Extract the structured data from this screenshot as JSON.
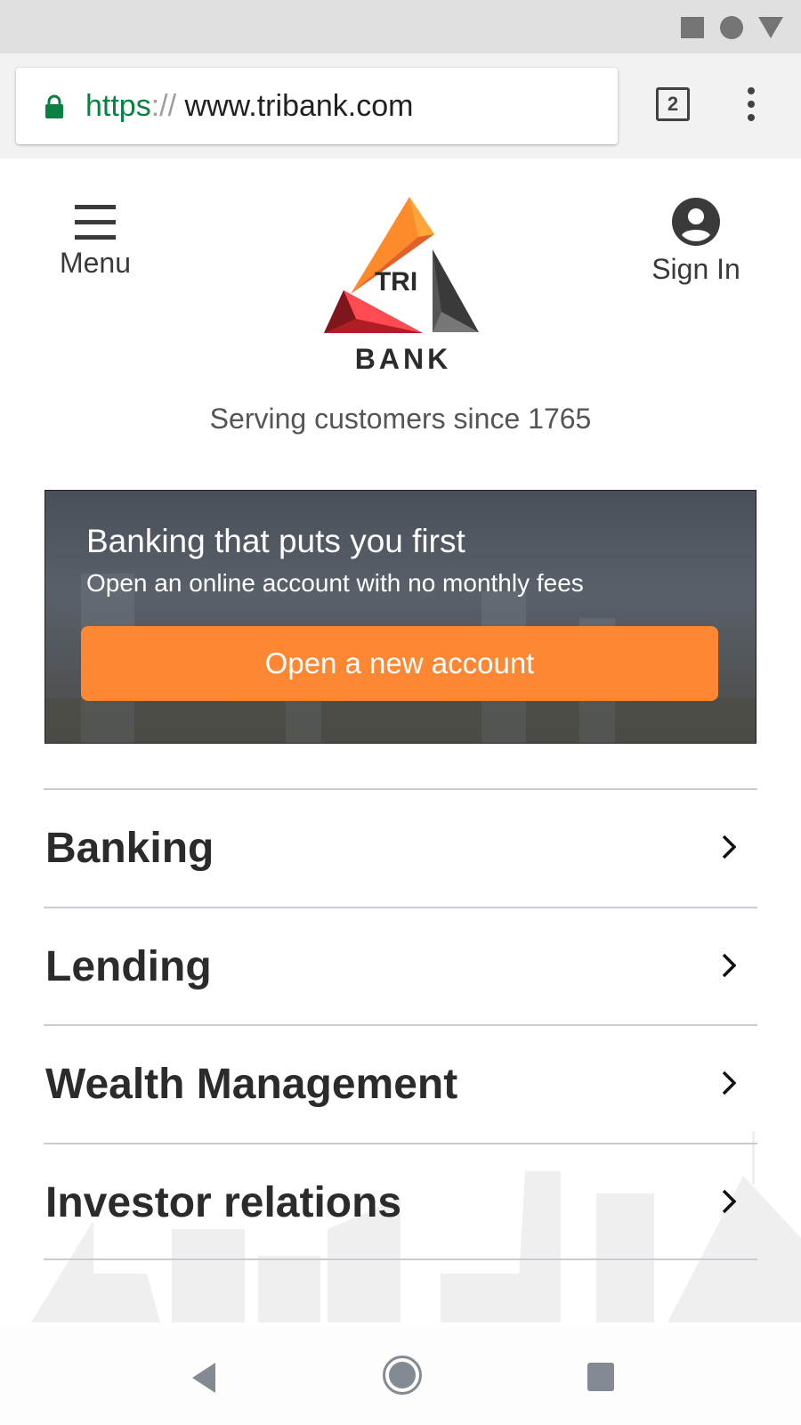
{
  "browser": {
    "url_scheme": "https",
    "url_sep": "://",
    "url_domain": " www.tribank.com",
    "tab_count": "2",
    "secure": true
  },
  "header": {
    "menu_label": "Menu",
    "signin_label": "Sign In",
    "logo_text_top": "TRI",
    "logo_text_bottom": "BANK",
    "tagline": "Serving customers since 1765"
  },
  "hero": {
    "title": "Banking that puts you first",
    "subtitle": "Open an online account with no monthly fees",
    "cta": "Open a new account",
    "cta_color": "#fe8734"
  },
  "nav": {
    "items": [
      {
        "label": "Banking"
      },
      {
        "label": "Lending"
      },
      {
        "label": "Wealth Management"
      },
      {
        "label": "Investor relations"
      }
    ]
  },
  "system_nav": {
    "icons": [
      "back-icon",
      "home-icon",
      "recents-icon"
    ]
  }
}
